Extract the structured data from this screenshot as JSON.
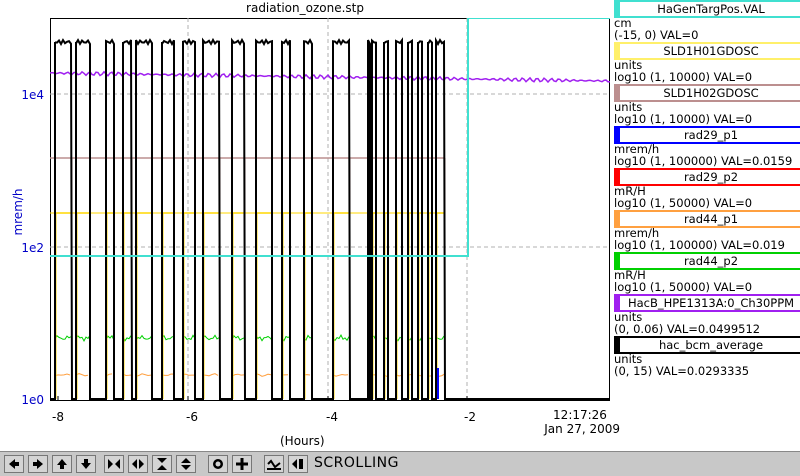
{
  "title": "radiation_ozone.stp",
  "y_axis": {
    "label": "mrem/h",
    "ticks": [
      "1e4",
      "1e2",
      "1e0"
    ]
  },
  "x_axis": {
    "label": "(Hours)",
    "ticks": [
      "-8",
      "-6",
      "-4",
      "-2"
    ],
    "time": "12:17:26",
    "date": "Jan 27, 2009"
  },
  "legend": [
    {
      "name": "HaGenTargPos.VAL",
      "unit": "cm",
      "range": "(-15, 0) VAL=0",
      "color": "#40e0d0"
    },
    {
      "name": "SLD1H01GDOSC",
      "unit": "units",
      "range": "log10 (1, 10000) VAL=0",
      "color": "#fff06a"
    },
    {
      "name": "SLD1H02GDOSC",
      "unit": "units",
      "range": "log10 (1, 10000) VAL=0",
      "color": "#bc8f8f"
    },
    {
      "name": "rad29_p1",
      "unit": "mrem/h",
      "range": "log10 (1, 100000) VAL=0.0159",
      "color": "#0000ff"
    },
    {
      "name": "rad29_p2",
      "unit": "mR/H",
      "range": "log10 (1, 50000) VAL=0",
      "color": "#ff0000"
    },
    {
      "name": "rad44_p1",
      "unit": "mrem/h",
      "range": "log10 (1, 100000) VAL=0.019",
      "color": "#ffa040"
    },
    {
      "name": "rad44_p2",
      "unit": "mR/H",
      "range": "log10 (1, 50000) VAL=0",
      "color": "#00d000"
    },
    {
      "name": "HacB_HPE1313A:0_Ch30PPM",
      "unit": "units",
      "range": "(0, 0.06) VAL=0.0499512",
      "color": "#a020f0"
    },
    {
      "name": "hac_bcm_average",
      "unit": "units",
      "range": "(0, 15) VAL=0.0293335",
      "color": "#000000"
    }
  ],
  "toolbar": {
    "status": "SCROLLING",
    "buttons": [
      "arrow-left-icon",
      "arrow-right-icon",
      "arrow-up-icon",
      "arrow-down-icon",
      "zoom-in-x-icon",
      "zoom-out-x-icon",
      "zoom-in-y-icon",
      "zoom-out-y-icon",
      "reset-icon",
      "cross-icon",
      "scroll-icon",
      "pause-icon"
    ]
  }
}
